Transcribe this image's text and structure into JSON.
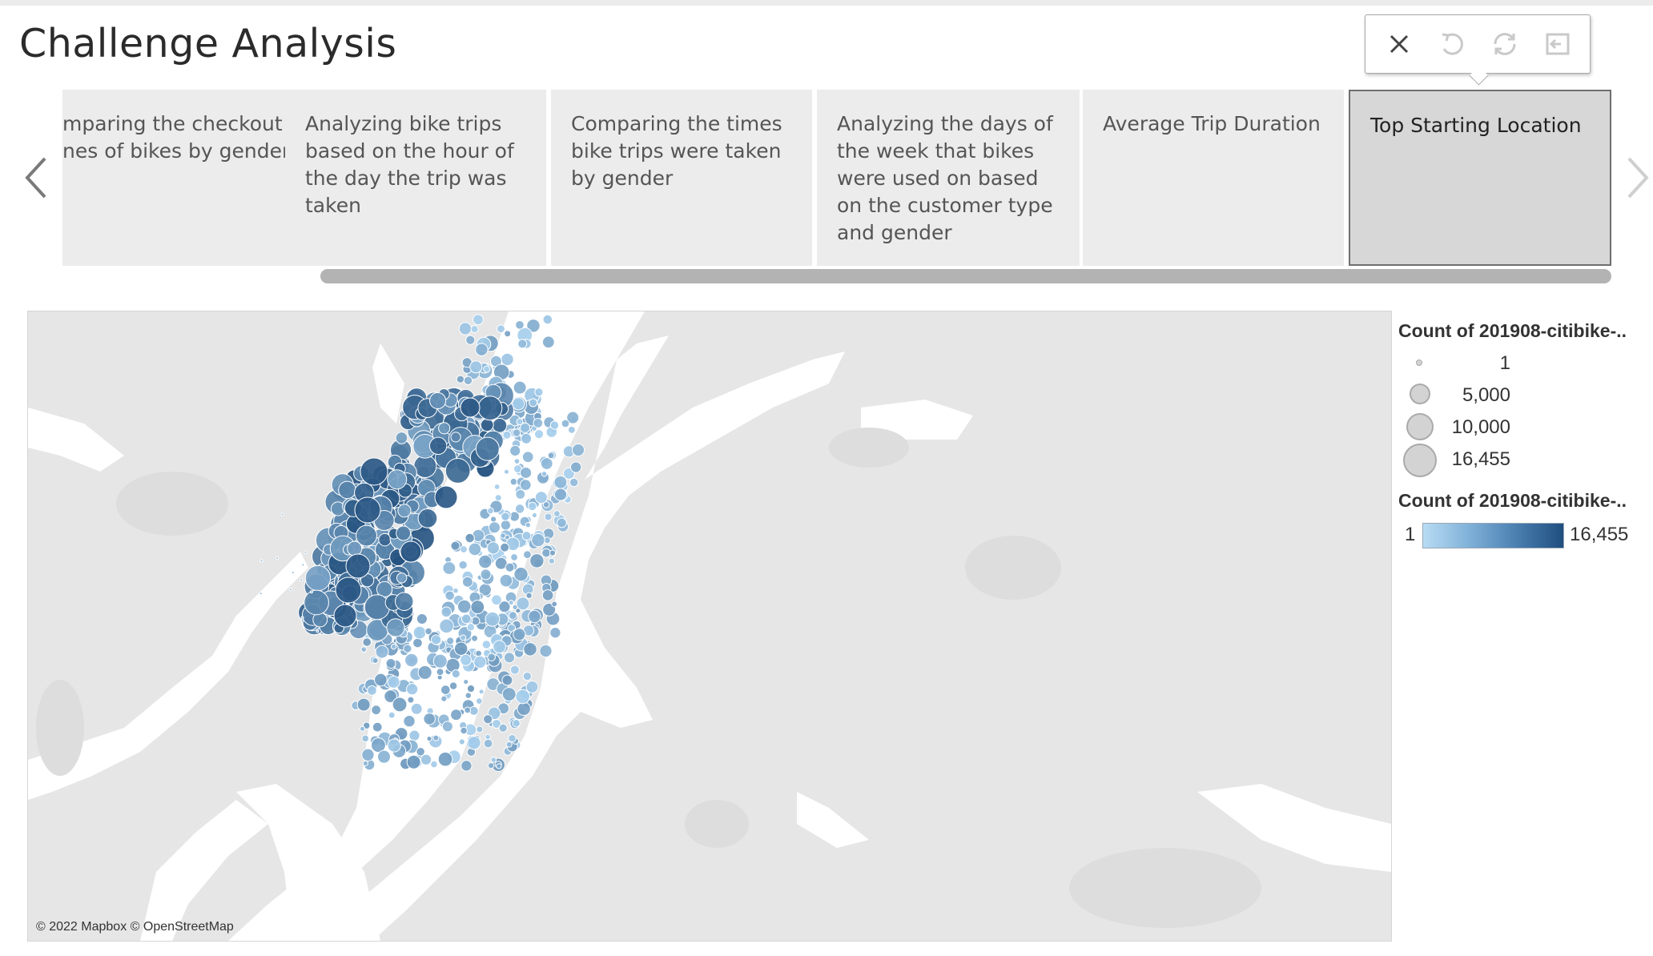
{
  "dashboard": {
    "title": "Challenge Analysis"
  },
  "toolbar": {
    "buttons": [
      {
        "name": "close",
        "icon": "close-icon",
        "enabled": true
      },
      {
        "name": "undo",
        "icon": "undo-icon",
        "enabled": false
      },
      {
        "name": "revert",
        "icon": "revert-icon",
        "enabled": false
      },
      {
        "name": "exit",
        "icon": "exit-icon",
        "enabled": false
      }
    ]
  },
  "story": {
    "points": [
      {
        "label": "mparing the checkout\nnes of bikes by gender",
        "active": false
      },
      {
        "label": "Analyzing bike trips based on the hour of the day the trip was taken",
        "active": false
      },
      {
        "label": "Comparing the times bike trips were taken by gender",
        "active": false
      },
      {
        "label": "Analyzing the days of the week that bikes were used on based on the customer type and gender",
        "active": false
      },
      {
        "label": "Average Trip Duration",
        "active": false
      },
      {
        "label": "Top Starting Location",
        "active": true
      }
    ],
    "prev_icon": "chevron-left-icon",
    "next_icon": "chevron-right-icon"
  },
  "map": {
    "attribution": "© 2022 Mapbox © OpenStreetMap",
    "colors": {
      "land": "#e6e6e6",
      "water": "#ffffff",
      "dot_light": "#a8d0ee",
      "dot_dark": "#24527f"
    }
  },
  "legend_size": {
    "title": "Count of 201908-citibike-..",
    "items": [
      {
        "label": "1"
      },
      {
        "label": "5,000"
      },
      {
        "label": "10,000"
      },
      {
        "label": "16,455"
      }
    ]
  },
  "legend_color": {
    "title": "Count of 201908-citibike-..",
    "min_label": "1",
    "max_label": "16,455",
    "colors": [
      "#b7dcf3",
      "#1f4e7f"
    ]
  }
}
